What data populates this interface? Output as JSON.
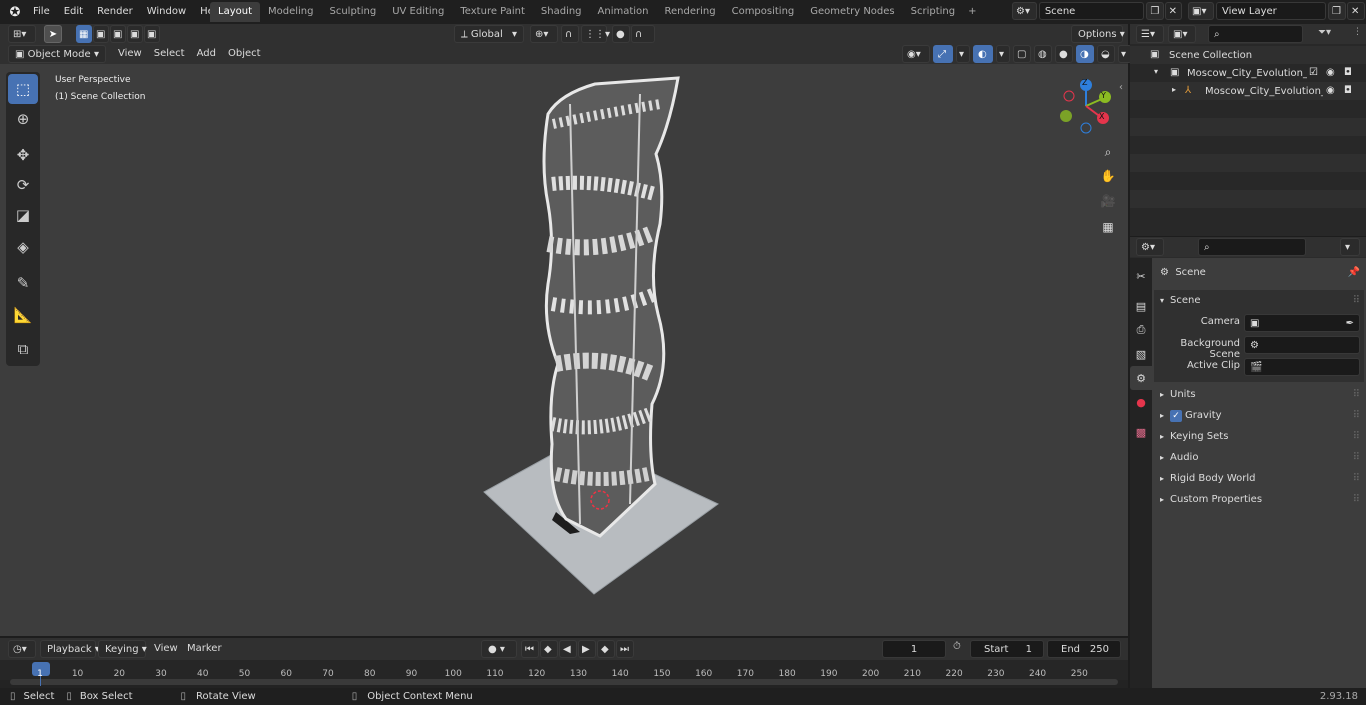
{
  "menu": {
    "items": [
      "File",
      "Edit",
      "Render",
      "Window",
      "Help"
    ]
  },
  "workspace_tabs": [
    "Layout",
    "Modeling",
    "Sculpting",
    "UV Editing",
    "Texture Paint",
    "Shading",
    "Animation",
    "Rendering",
    "Compositing",
    "Geometry Nodes",
    "Scripting"
  ],
  "active_tab": "Layout",
  "scene_name": "Scene",
  "view_layer": "View Layer",
  "viewport_header": {
    "mode": "Object Mode",
    "menus": [
      "View",
      "Select",
      "Add",
      "Object"
    ],
    "orientation": "Global",
    "options": "Options"
  },
  "viewport": {
    "perspective_label": "User Perspective",
    "collection_label": "(1) Scene Collection"
  },
  "gizmo": {
    "x": "X",
    "y": "Y",
    "z": "Z"
  },
  "outliner": {
    "root": "Scene Collection",
    "items": [
      "Moscow_City_Evolution_Towe",
      "Moscow_City_Evolution_"
    ]
  },
  "properties": {
    "context": "Scene",
    "section": "Scene",
    "fields": [
      {
        "label": "Camera",
        "value": ""
      },
      {
        "label": "Background Scene",
        "value": ""
      },
      {
        "label": "Active Clip",
        "value": ""
      }
    ],
    "panels": [
      "Units",
      "Gravity",
      "Keying Sets",
      "Audio",
      "Rigid Body World",
      "Custom Properties"
    ]
  },
  "timeline": {
    "menus": [
      "Playback",
      "Keying",
      "View",
      "Marker"
    ],
    "current_frame": "1",
    "start_label": "Start",
    "start": "1",
    "end_label": "End",
    "end": "250",
    "ticks": [
      "1",
      "10",
      "20",
      "30",
      "40",
      "50",
      "60",
      "70",
      "80",
      "90",
      "100",
      "110",
      "120",
      "130",
      "140",
      "150",
      "160",
      "170",
      "180",
      "190",
      "200",
      "210",
      "220",
      "230",
      "240",
      "250"
    ]
  },
  "statusbar": {
    "select": "Select",
    "box_select": "Box Select",
    "rotate": "Rotate View",
    "context_menu": "Object Context Menu",
    "version": "2.93.18"
  },
  "colors": {
    "accent": "#4772b3",
    "x_axis": "#e5354c",
    "y_axis": "#8bbb22",
    "z_axis": "#2e7fdc"
  }
}
